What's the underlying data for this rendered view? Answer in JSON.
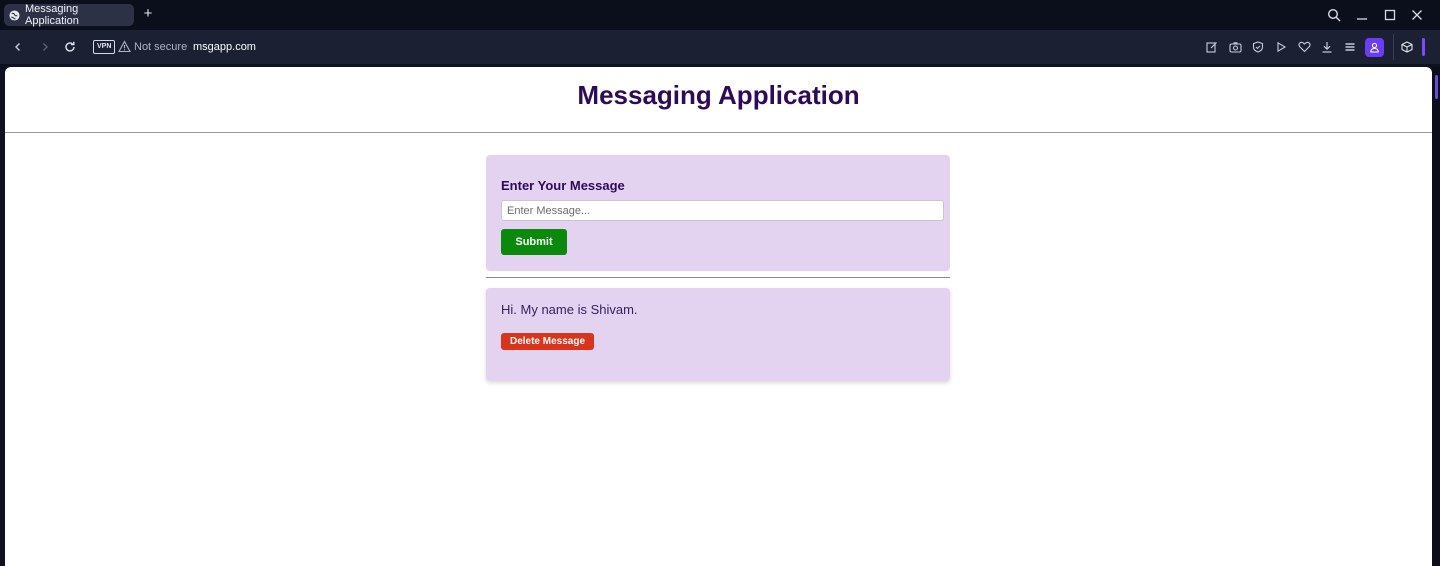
{
  "browser": {
    "tab_title": "Messaging Application",
    "new_tab_symbol": "+",
    "vpn_label": "VPN",
    "security_label": "Not secure",
    "url_host": "msgapp.com",
    "icons": [
      "back-icon",
      "forward-icon",
      "reload-icon",
      "warning-icon",
      "edit-icon",
      "camera-icon",
      "shield-icon",
      "play-icon",
      "heart-icon",
      "download-icon",
      "menu-icon",
      "profile-icon",
      "box-icon",
      "search-icon",
      "minimize-icon",
      "maximize-icon",
      "close-icon"
    ],
    "accent_color": "#6a3cf5"
  },
  "page": {
    "title": "Messaging Application",
    "title_color": "#2e0a5a",
    "card_color": "#e3d3f0"
  },
  "form": {
    "label": "Enter Your Message",
    "input_value": "",
    "input_placeholder": "Enter Message...",
    "submit_label": "Submit",
    "submit_color": "#0a8a0a"
  },
  "messages": [
    {
      "text": "Hi. My name is Shivam.",
      "delete_label": "Delete Message",
      "delete_color": "#d9341c"
    }
  ]
}
